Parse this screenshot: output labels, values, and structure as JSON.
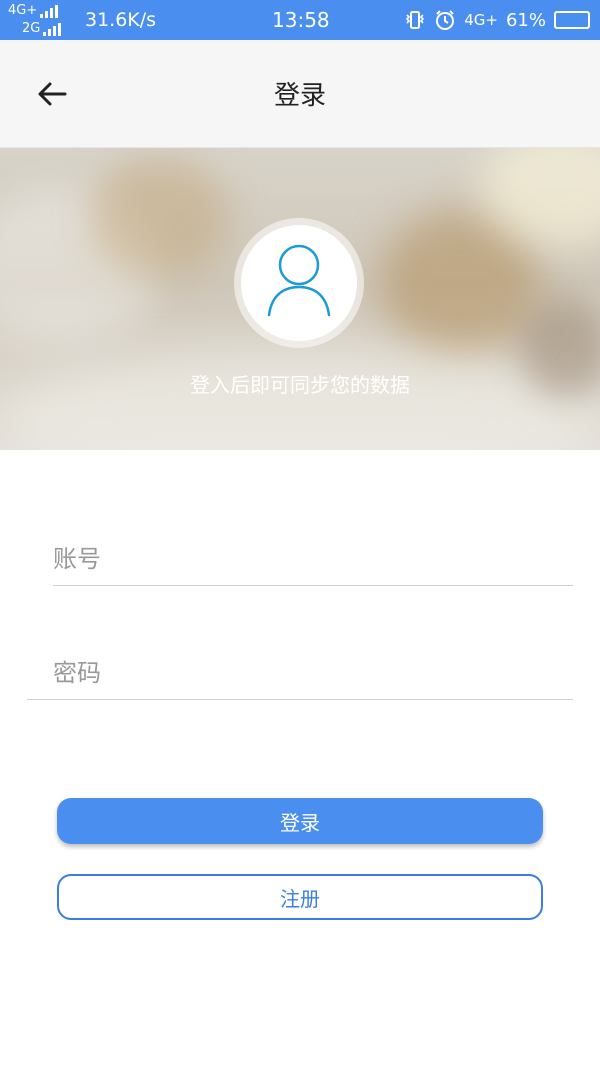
{
  "status_bar": {
    "network_top": "4G+",
    "network_bottom": "2G",
    "speed": "31.6K/s",
    "time": "13:58",
    "network_right": "4G+",
    "battery_percent": "61%",
    "battery_level": 0.61
  },
  "header": {
    "title": "登录",
    "back_icon": "arrow-left-icon"
  },
  "banner": {
    "avatar_icon": "user-icon",
    "caption": "登入后即可同步您的数据"
  },
  "form": {
    "account_placeholder": "账号",
    "password_placeholder": "密码",
    "login_label": "登录",
    "register_label": "注册"
  },
  "colors": {
    "accent": "#4a8ff0",
    "register_border": "#3a7fe0"
  }
}
